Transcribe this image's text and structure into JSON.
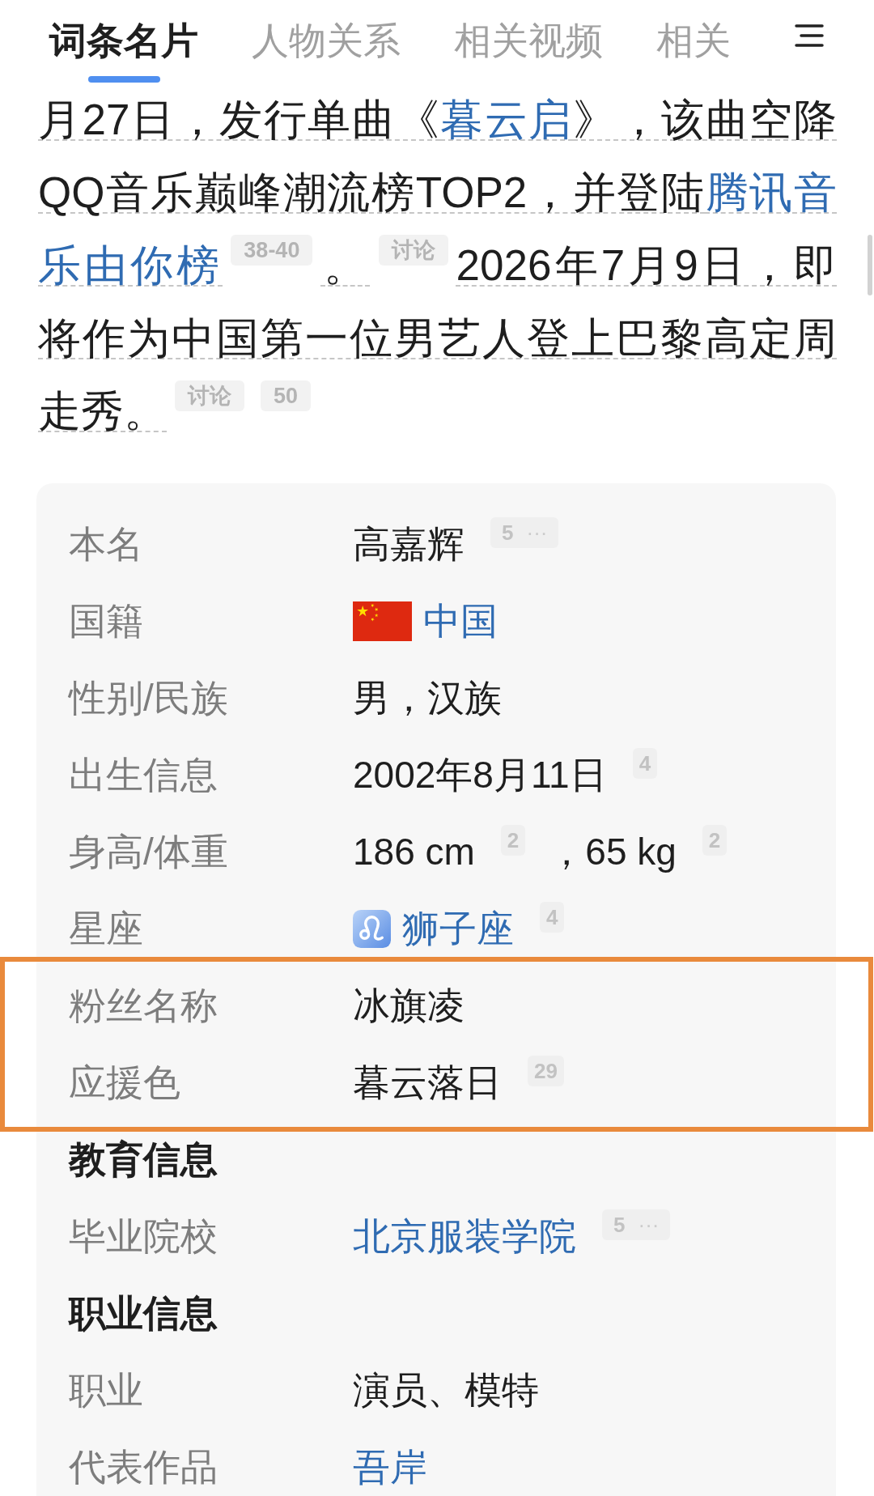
{
  "tabs": [
    {
      "label": "词条名片",
      "selected": true
    },
    {
      "label": "人物关系",
      "selected": false
    },
    {
      "label": "相关视频",
      "selected": false
    },
    {
      "label": "相关",
      "selected": false
    }
  ],
  "intro": {
    "lines": [
      [
        {
          "kind": "text",
          "text": "月27日，发行单曲《"
        },
        {
          "kind": "link",
          "text": "暮云启"
        },
        {
          "kind": "text",
          "text": "》，该曲空降"
        }
      ],
      [
        {
          "kind": "text",
          "text": "QQ音乐巅峰潮流榜TOP2，并登陆"
        },
        {
          "kind": "link",
          "text": "腾讯音"
        }
      ],
      [
        {
          "kind": "link",
          "text": "乐由你榜"
        },
        {
          "kind": "ref",
          "text": "38-40"
        },
        {
          "kind": "text",
          "text": "。"
        },
        {
          "kind": "ref",
          "text": "讨论"
        },
        {
          "kind": "text",
          "text": "2026年7月9日，即"
        }
      ],
      [
        {
          "kind": "text",
          "text": "将作为中国第一位男艺人登上巴黎高定周"
        }
      ],
      [
        {
          "kind": "text",
          "text": "走秀。"
        },
        {
          "kind": "ref",
          "text": "讨论"
        },
        {
          "kind": "ref",
          "text": "50"
        }
      ]
    ]
  },
  "infobox": {
    "rows": [
      {
        "kind": "field",
        "label": "本名",
        "highlighted": false,
        "value": [
          {
            "kind": "text",
            "text": "高嘉辉"
          },
          {
            "kind": "ref",
            "text": "5",
            "extra": "···"
          }
        ]
      },
      {
        "kind": "field",
        "label": "国籍",
        "highlighted": false,
        "value": [
          {
            "kind": "flag"
          },
          {
            "kind": "link",
            "text": "中国"
          }
        ]
      },
      {
        "kind": "field",
        "label": "性别/民族",
        "highlighted": false,
        "value": [
          {
            "kind": "text",
            "text": "男，汉族"
          }
        ]
      },
      {
        "kind": "field",
        "label": "出生信息",
        "highlighted": false,
        "value": [
          {
            "kind": "text",
            "text": "2002年8月11日"
          },
          {
            "kind": "ref",
            "text": "4"
          }
        ]
      },
      {
        "kind": "field",
        "label": "身高/体重",
        "highlighted": false,
        "value": [
          {
            "kind": "text",
            "text": "186 cm"
          },
          {
            "kind": "ref",
            "text": "2"
          },
          {
            "kind": "text",
            "text": "，65 kg"
          },
          {
            "kind": "ref",
            "text": "2"
          }
        ]
      },
      {
        "kind": "field",
        "label": "星座",
        "highlighted": false,
        "value": [
          {
            "kind": "symbol"
          },
          {
            "kind": "link",
            "text": "狮子座"
          },
          {
            "kind": "ref",
            "text": "4"
          }
        ]
      },
      {
        "kind": "field",
        "label": "粉丝名称",
        "highlighted": true,
        "value": [
          {
            "kind": "text",
            "text": "冰旗凌"
          }
        ]
      },
      {
        "kind": "field",
        "label": "应援色",
        "highlighted": true,
        "value": [
          {
            "kind": "text",
            "text": "暮云落日"
          },
          {
            "kind": "ref",
            "text": "29"
          }
        ]
      },
      {
        "kind": "heading",
        "label": "教育信息",
        "highlighted": false
      },
      {
        "kind": "field",
        "label": "毕业院校",
        "highlighted": false,
        "value": [
          {
            "kind": "link",
            "text": "北京服装学院"
          },
          {
            "kind": "ref",
            "text": "5",
            "extra": "···"
          }
        ]
      },
      {
        "kind": "heading",
        "label": "职业信息",
        "highlighted": false
      },
      {
        "kind": "field",
        "label": "职业",
        "highlighted": false,
        "value": [
          {
            "kind": "text",
            "text": "演员、模特"
          }
        ]
      },
      {
        "kind": "field",
        "label": "代表作品",
        "highlighted": false,
        "value": [
          {
            "kind": "link",
            "text": "吾岸"
          }
        ]
      }
    ]
  }
}
